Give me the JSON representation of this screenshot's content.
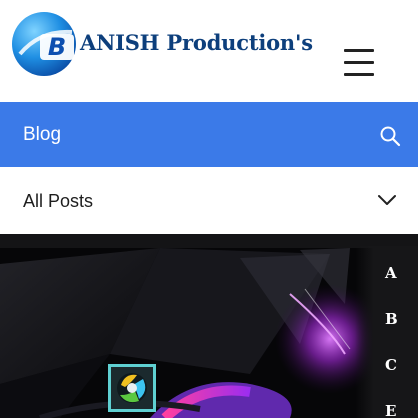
{
  "header": {
    "logo_letter": "B",
    "brand": "ANISH Production's",
    "menu_icon": "hamburger-menu-icon"
  },
  "blog_bar": {
    "label": "Blog",
    "search_icon": "search-icon"
  },
  "posts_filter": {
    "label": "All Posts",
    "dropdown_icon": "chevron-down-icon"
  },
  "banner": {
    "side_letters": [
      "A",
      "B",
      "C",
      "E"
    ]
  },
  "colors": {
    "brand_text": "#0d3f7c",
    "blog_bar": "#3b7ae8",
    "logo_blue": "#1f8fe3",
    "banner_bg": "#060608",
    "accent_magenta": "#c43cf0"
  }
}
